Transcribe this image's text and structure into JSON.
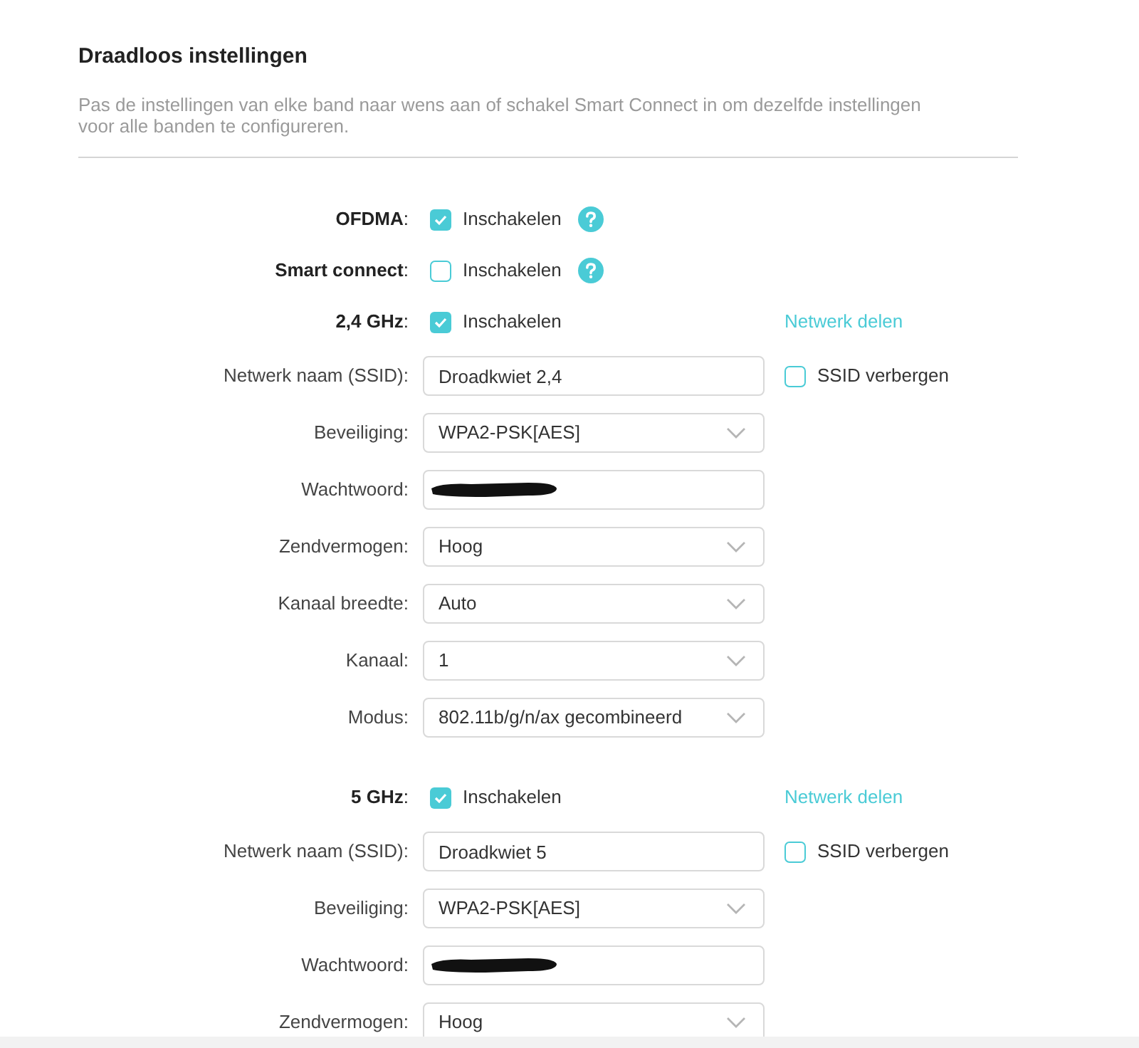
{
  "title": "Draadloos instellingen",
  "description": "Pas de instellingen van elke band naar wens aan of schakel Smart Connect in om dezelfde instellingen voor alle banden te configureren.",
  "features": [
    {
      "label": "**OFDMA**:",
      "checked": true,
      "option": "Inschakelen",
      "help": true
    },
    {
      "label": "**Smart connect**:",
      "checked": false,
      "option": "Inschakelen",
      "help": true
    }
  ],
  "bands": [
    {
      "label": "**2,4 GHz**:",
      "checked": true,
      "option": "Inschakelen",
      "link": "Netwerk delen",
      "fields": [
        {
          "kind": "text",
          "label": "Netwerk naam (SSID):",
          "value": "Droadkwiet 2,4",
          "side_option": {
            "label": "SSID verbergen",
            "checked": false
          }
        },
        {
          "kind": "select",
          "label": "Beveiliging:",
          "value": "WPA2-PSK[AES]"
        },
        {
          "kind": "password",
          "label": "Wachtwoord:"
        },
        {
          "kind": "select",
          "label": "Zendvermogen:",
          "value": "Hoog"
        },
        {
          "kind": "select",
          "label": "Kanaal breedte:",
          "value": "Auto"
        },
        {
          "kind": "select",
          "label": "Kanaal:",
          "value": "1"
        },
        {
          "kind": "select",
          "label": "Modus:",
          "value": "802.11b/g/n/ax gecombineerd"
        }
      ]
    },
    {
      "label": "**5 GHz**:",
      "checked": true,
      "option": "Inschakelen",
      "link": "Netwerk delen",
      "fields": [
        {
          "kind": "text",
          "label": "Netwerk naam (SSID):",
          "value": "Droadkwiet 5",
          "side_option": {
            "label": "SSID verbergen",
            "checked": false
          }
        },
        {
          "kind": "select",
          "label": "Beveiliging:",
          "value": "WPA2-PSK[AES]"
        },
        {
          "kind": "password",
          "label": "Wachtwoord:"
        },
        {
          "kind": "select",
          "label": "Zendvermogen:",
          "value": "Hoog"
        }
      ]
    }
  ]
}
